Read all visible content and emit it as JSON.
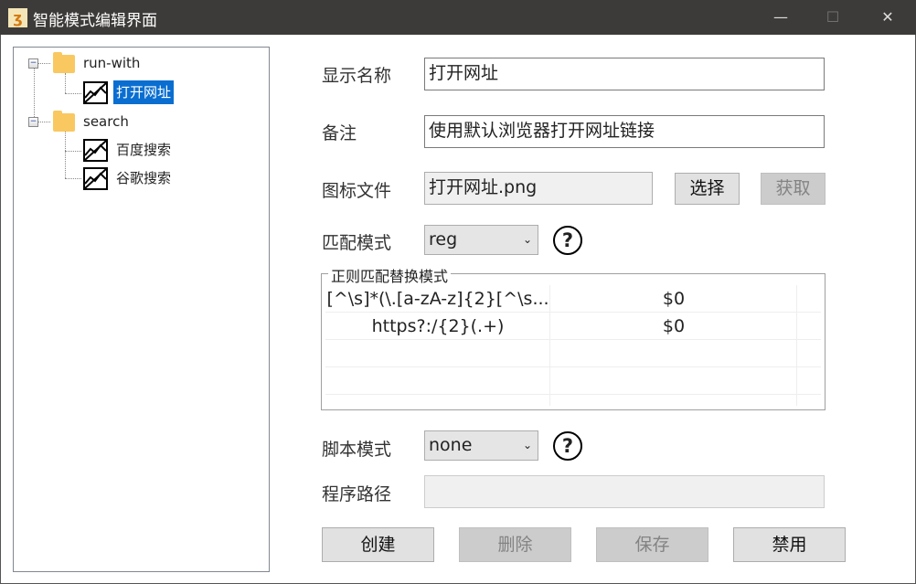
{
  "window": {
    "title": "智能模式编辑界面",
    "minimize": "—",
    "maximize": "☐",
    "close": "✕"
  },
  "tree": [
    {
      "label": "run-with",
      "type": "folder",
      "children": [
        {
          "label": "打开网址",
          "selected": true
        }
      ]
    },
    {
      "label": "search",
      "type": "folder",
      "children": [
        {
          "label": "百度搜索"
        },
        {
          "label": "谷歌搜索"
        }
      ]
    }
  ],
  "form": {
    "display_name_label": "显示名称",
    "display_name": "打开网址",
    "note_label": "备注",
    "note": "使用默认浏览器打开网址链接",
    "icon_label": "图标文件",
    "icon_file": "打开网址.png",
    "choose": "选择",
    "fetch": "获取",
    "match_label": "匹配模式",
    "match_mode": "reg",
    "group_title": "正则匹配替换模式",
    "rules": [
      {
        "pattern": "[^\\s]*(\\.[a-zA-z]{2}[^\\s...",
        "replace": "$0"
      },
      {
        "pattern": "https?:/{2}(.+)",
        "replace": "$0"
      }
    ],
    "script_label": "脚本模式",
    "script_mode": "none",
    "path_label": "程序路径",
    "path": ""
  },
  "buttons": {
    "create": "创建",
    "delete": "删除",
    "save": "保存",
    "disable": "禁用"
  },
  "colors": {
    "selection": "#0a6ed1",
    "titlebar": "#3d3b39"
  }
}
